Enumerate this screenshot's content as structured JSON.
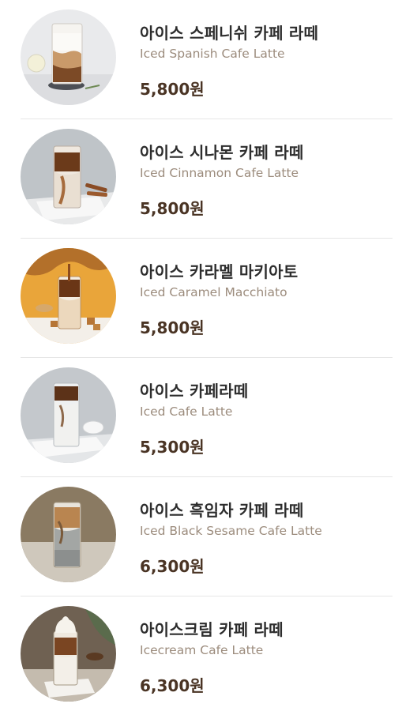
{
  "menu": {
    "items": [
      {
        "name_ko": "아이스 스페니쉬 카페 라떼",
        "name_en": "Iced Spanish Cafe Latte",
        "price": "5,800원"
      },
      {
        "name_ko": "아이스 시나몬 카페 라떼",
        "name_en": "Iced Cinnamon Cafe Latte",
        "price": "5,800원"
      },
      {
        "name_ko": "아이스 카라멜 마키아토",
        "name_en": "Iced Caramel Macchiato",
        "price": "5,800원"
      },
      {
        "name_ko": "아이스 카페라떼",
        "name_en": "Iced Cafe Latte",
        "price": "5,300원"
      },
      {
        "name_ko": "아이스 흑임자 카페 라떼",
        "name_en": "Iced Black Sesame Cafe Latte",
        "price": "6,300원"
      },
      {
        "name_ko": "아이스크림 카페 라떼",
        "name_en": "Icecream Cafe Latte",
        "price": "6,300원"
      }
    ]
  },
  "colors": {
    "name_ko": "#2d2d2d",
    "name_en": "#9c8c7d",
    "price": "#4a3424",
    "divider": "#e6e6e6"
  }
}
